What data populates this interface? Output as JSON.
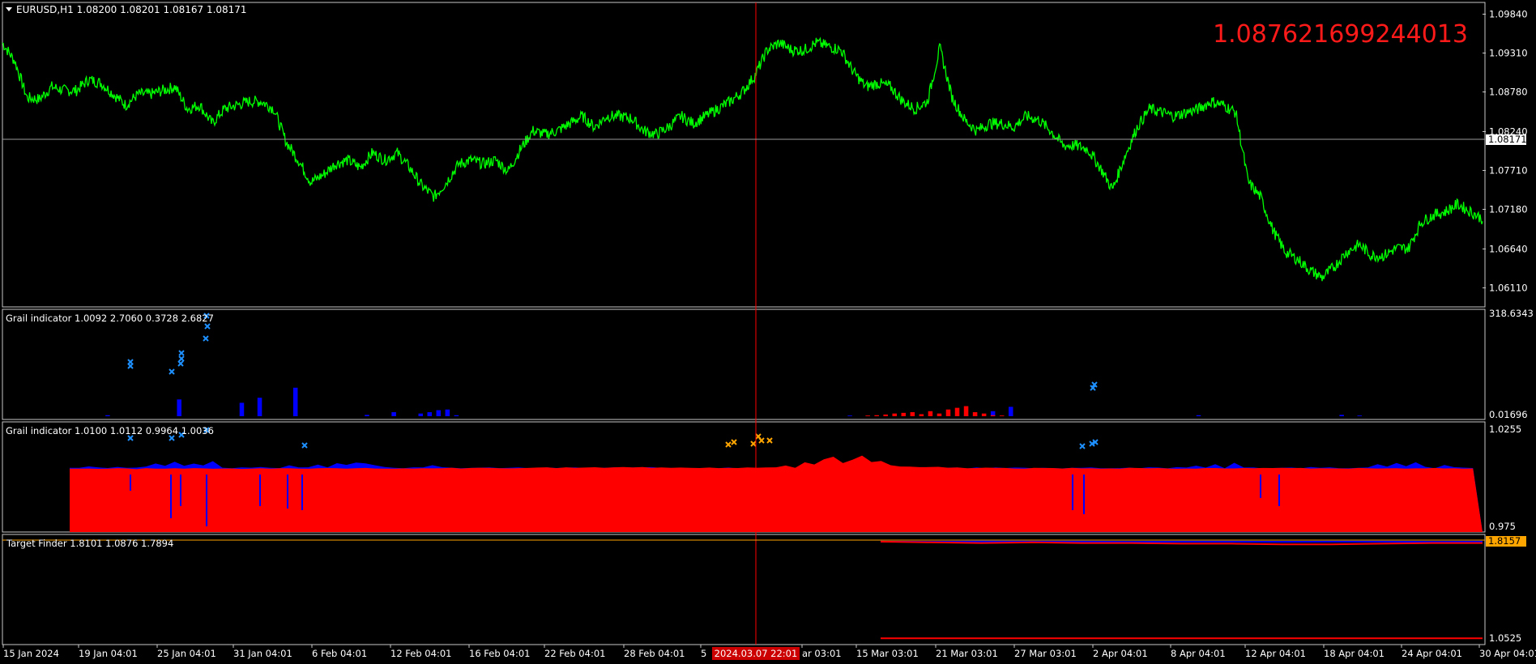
{
  "colors": {
    "background": "#000000",
    "frame": "#c8c8c8",
    "price_line": "#00ff00",
    "grail_blue": "#0000ff",
    "grail_red": "#ff0000",
    "marker_blue": "#1e90ff",
    "marker_orange": "#ffa500",
    "crosshair": "#ff0000",
    "bid_line": "#9a9a9a",
    "target_line": "#ffa500",
    "big_value": "#ff1a1a",
    "text": "#ffffff"
  },
  "main": {
    "header": "EURUSD,H1  1.08200 1.08201 1.08167 1.08171",
    "overlay_value": "1.087621699244013",
    "current_price_tag": "1.08171"
  },
  "grail1": {
    "header": "Grail indicator 1.0092 2.7060 0.3728 2.6827"
  },
  "grail2": {
    "header": "Grail indicator 1.0100 1.0112 0.9964 1.0036"
  },
  "target": {
    "header": "Target Finder 1.8101 1.0876 1.7894",
    "tag": "1.8157"
  },
  "crosshair_date": "2024.03.07 22:01",
  "chart_data": [
    {
      "panel": "main",
      "type": "line",
      "title": "EURUSD,H1",
      "ylim": [
        1.0585,
        1.1
      ],
      "y_ticks": [
        "1.09840",
        "1.09310",
        "1.08780",
        "1.08240",
        "1.07710",
        "1.07180",
        "1.06640",
        "1.06110"
      ],
      "x_ticks": [
        "15 Jan 2024",
        "19 Jan 04:01",
        "25 Jan 04:01",
        "31 Jan 04:01",
        "6 Feb 04:01",
        "12 Feb 04:01",
        "16 Feb 04:01",
        "22 Feb 04:01",
        "28 Feb 04:01",
        "5",
        "ar 03:01",
        "15 Mar 03:01",
        "21 Mar 03:01",
        "27 Mar 03:01",
        "2 Apr 04:01",
        "8 Apr 04:01",
        "12 Apr 04:01",
        "18 Apr 04:01",
        "24 Apr 04:01",
        "30 Apr 04:01"
      ],
      "series": [
        {
          "values": [
            1.0945,
            1.092,
            1.087,
            1.0868,
            1.0885,
            1.088,
            1.088,
            1.0895,
            1.089,
            1.0875,
            1.086,
            1.0875,
            1.0875,
            1.088,
            1.0885,
            1.0855,
            1.086,
            1.0835,
            1.0855,
            1.086,
            1.0865,
            1.0865,
            1.0855,
            1.081,
            1.0785,
            1.0755,
            1.0765,
            1.078,
            1.0785,
            1.0775,
            1.0795,
            1.0785,
            1.0795,
            1.0775,
            1.075,
            1.0735,
            1.0755,
            1.078,
            1.0785,
            1.078,
            1.0785,
            1.077,
            1.08,
            1.0825,
            1.082,
            1.0825,
            1.0835,
            1.0845,
            1.083,
            1.0845,
            1.0845,
            1.0842,
            1.0825,
            1.082,
            1.083,
            1.0845,
            1.0835,
            1.0845,
            1.0855,
            1.0865,
            1.0878,
            1.09,
            1.0935,
            1.0945,
            1.0935,
            1.0935,
            1.0945,
            1.094,
            1.0935,
            1.0905,
            1.0885,
            1.089,
            1.0885,
            1.0865,
            1.0855,
            1.0865,
            1.0938,
            1.087,
            1.084,
            1.0825,
            1.0835,
            1.0835,
            1.083,
            1.0845,
            1.084,
            1.0825,
            1.0805,
            1.0805,
            1.08,
            1.0775,
            1.0745,
            1.079,
            1.083,
            1.0855,
            1.085,
            1.0845,
            1.085,
            1.0855,
            1.0865,
            1.086,
            1.085,
            1.0755,
            1.0735,
            1.069,
            1.066,
            1.065,
            1.0635,
            1.0625,
            1.064,
            1.066,
            1.067,
            1.0655,
            1.0655,
            1.0665,
            1.0665,
            1.07,
            1.071,
            1.0715,
            1.0725,
            1.0715,
            1.0705
          ]
        }
      ]
    },
    {
      "panel": "grail1",
      "type": "bar",
      "title": "Grail indicator",
      "ylim": [
        0,
        318.6343
      ],
      "y_ticks": [
        "318.6343",
        "0.01696"
      ],
      "series": [
        {
          "name": "blue",
          "values": [
            0,
            0,
            0,
            0,
            3,
            0,
            0,
            0,
            0,
            0,
            0,
            0,
            50,
            0,
            0,
            0,
            0,
            0,
            0,
            40,
            0,
            55,
            0,
            0,
            0,
            85,
            0,
            0,
            0,
            0,
            0,
            0,
            0,
            4,
            0,
            0,
            12,
            0,
            0,
            8,
            12,
            18,
            20,
            3,
            0,
            0,
            0,
            0,
            0,
            0,
            0,
            0,
            0,
            0,
            0,
            0,
            0,
            0,
            0,
            0,
            0,
            0,
            0,
            0,
            0,
            0,
            0,
            0,
            0,
            0,
            0,
            0,
            0,
            0,
            0,
            0,
            0,
            0,
            0,
            0,
            0,
            0,
            0,
            0,
            0,
            0,
            0,
            2,
            0,
            0,
            0,
            0,
            0,
            0,
            0,
            0,
            0,
            0,
            0,
            0,
            4,
            3,
            0,
            15,
            0,
            28,
            0,
            0,
            0,
            0,
            0,
            0,
            0,
            0,
            0,
            0,
            0,
            0,
            0,
            0,
            0,
            0,
            0,
            0,
            0,
            0,
            3,
            0,
            0,
            0,
            0,
            0,
            0,
            0,
            0,
            0,
            0,
            0,
            0,
            0,
            0,
            0,
            4,
            0,
            2,
            0,
            0,
            0,
            0,
            0,
            0,
            0,
            0,
            0,
            0,
            0,
            0,
            0
          ]
        },
        {
          "name": "red",
          "values": [
            0,
            0,
            0,
            0,
            0,
            0,
            0,
            0,
            0,
            0,
            0,
            0,
            0,
            0,
            0,
            0,
            0,
            0,
            0,
            0,
            0,
            0,
            0,
            0,
            0,
            0,
            0,
            0,
            0,
            0,
            0,
            0,
            0,
            0,
            0,
            0,
            0,
            0,
            0,
            0,
            0,
            0,
            0,
            0,
            0,
            0,
            0,
            0,
            0,
            0,
            0,
            0,
            0,
            0,
            0,
            0,
            0,
            0,
            0,
            0,
            0,
            0,
            0,
            0,
            0,
            0,
            0,
            0,
            0,
            0,
            0,
            0,
            0,
            0,
            0,
            0,
            0,
            0,
            0,
            0,
            0,
            0,
            0,
            0,
            0,
            0,
            0,
            0,
            0,
            2,
            3,
            5,
            8,
            10,
            12,
            6,
            15,
            8,
            20,
            25,
            30,
            12,
            8,
            3,
            2,
            0,
            0,
            0,
            0,
            0,
            0,
            0,
            0,
            0,
            0,
            0,
            0,
            0,
            0,
            0,
            0,
            0,
            0,
            0,
            0,
            0,
            0,
            0,
            0,
            0,
            0,
            0,
            0,
            0,
            0,
            0,
            0,
            0,
            0,
            0,
            0,
            0,
            0,
            0,
            0,
            0,
            0,
            0,
            0,
            0,
            0,
            0,
            0,
            0,
            0,
            0,
            0,
            0
          ]
        }
      ]
    },
    {
      "panel": "grail2",
      "type": "area",
      "title": "Grail indicator",
      "ylim": [
        0.975,
        1.0255
      ],
      "y_ticks": [
        "1.0255",
        "0.975"
      ],
      "series": [
        {
          "name": "blue",
          "values": [
            0,
            0,
            0,
            0,
            0,
            0,
            0,
            0,
            0,
            0,
            1.0045,
            1.0042,
            1.005,
            1.0043,
            1.0044,
            1.0046,
            1.0045,
            1.0044,
            1.0048,
            1.0062,
            1.0055,
            1.007,
            1.0052,
            1.0065,
            1.0058,
            1.0075,
            1.0046,
            1.0045,
            1.0047,
            1.0045,
            1.0045,
            1.0044,
            1.0045,
            1.0058,
            1.0046,
            1.0045,
            1.0062,
            1.0045,
            1.0065,
            1.0055,
            1.007,
            1.0062,
            1.0058,
            1.0048,
            1.0046,
            1.0045,
            1.0044,
            1.0045,
            1.0054,
            1.0045,
            1.0044,
            1.0045,
            1.0044,
            1.0045,
            1.0044,
            1.0045,
            1.0044,
            1.0045,
            1.0044,
            1.0045,
            1.0044,
            1.0045,
            1.0044,
            1.0045,
            1.0044,
            1.0045,
            1.0044,
            1.0045,
            1.0044,
            1.0045,
            1.0044,
            1.0045,
            1.0044,
            1.0045,
            1.0044,
            1.0045,
            1.0044,
            1.0045,
            1.0044,
            1.0045,
            1.0044,
            1.0045,
            1.0044,
            1.0045,
            1.0044,
            1.0045,
            1.0044,
            1.0045,
            1.0044,
            1.0045,
            1.0044,
            1.0045,
            1.0044,
            1.0045,
            1.0044,
            1.0045,
            1.0044,
            1.0045,
            1.0044,
            1.0045,
            1.0044,
            1.0045,
            1.0044,
            1.0045,
            1.0044,
            1.0045,
            1.0044,
            1.0045,
            1.0044,
            1.0045,
            1.0044,
            1.0045,
            1.0044,
            1.0045,
            1.0044,
            1.0045,
            1.0044,
            1.0045,
            1.0044,
            1.0045,
            1.0044,
            1.0045,
            1.0044,
            1.0048,
            1.0045,
            1.0044,
            1.0045,
            1.0044,
            1.0055,
            1.0045,
            1.0062,
            1.0045,
            1.0068,
            1.0044,
            1.0045,
            1.0044,
            1.0045,
            1.0044,
            1.0045,
            1.0044,
            1.0045,
            1.0044,
            1.0045,
            1.0044,
            1.0045,
            1.0044,
            1.0045,
            1.006,
            1.0048,
            1.0065,
            1.0052,
            1.0068,
            1.0048,
            1.0045,
            1.0055,
            1.0046,
            1.0045,
            1.0044,
            1.0045,
            1.0044,
            1.0045
          ]
        },
        {
          "name": "red",
          "values": [
            0,
            0,
            0,
            0,
            0,
            0,
            0,
            0,
            0,
            0,
            1.0042,
            1.0041,
            1.0042,
            1.004,
            1.0041,
            1.0042,
            1.0041,
            1.004,
            1.0042,
            1.0042,
            1.0041,
            1.0042,
            1.0041,
            1.0042,
            1.0041,
            1.004,
            1.0041,
            1.0042,
            1.0041,
            1.0042,
            1.0041,
            1.0042,
            1.0041,
            1.0042,
            1.0041,
            1.0042,
            1.0041,
            1.0042,
            1.0041,
            1.0042,
            1.0041,
            1.0042,
            1.0041,
            1.0042,
            1.0041,
            1.0042,
            1.0041,
            1.0042,
            1.0043,
            1.0042,
            1.0043,
            1.0042,
            1.0043,
            1.0044,
            1.0043,
            1.0044,
            1.0043,
            1.0044,
            1.0045,
            1.0044,
            1.0045,
            1.0044,
            1.0045,
            1.0046,
            1.0045,
            1.0046,
            1.0045,
            1.0046,
            1.0047,
            1.0046,
            1.0047,
            1.0046,
            1.0047,
            1.0046,
            1.0047,
            1.0046,
            1.0045,
            1.0046,
            1.0045,
            1.0046,
            1.0045,
            1.0046,
            1.0045,
            1.0046,
            1.0045,
            1.0055,
            1.0046,
            1.007,
            1.006,
            1.0085,
            1.0095,
            1.0065,
            1.008,
            1.01,
            1.007,
            1.0075,
            1.0055,
            1.005,
            1.0048,
            1.0047,
            1.0046,
            1.0047,
            1.0046,
            1.0045,
            1.0044,
            1.0045,
            1.0044,
            1.0043,
            1.0044,
            1.0043,
            1.0042,
            1.0043,
            1.0042,
            1.0043,
            1.0042,
            1.0043,
            1.0042,
            1.0043,
            1.0042,
            1.0043,
            1.0042,
            1.0043,
            1.0042,
            1.0043,
            1.0042,
            1.0043,
            1.0042,
            1.0043,
            1.0042,
            1.0043,
            1.0042,
            1.0043,
            1.0042,
            1.0043,
            1.0042,
            1.0043,
            1.0042,
            1.0043,
            1.0042,
            1.0043,
            1.0042,
            1.0043,
            1.0042,
            1.0043,
            1.0042,
            1.0043,
            1.0042,
            1.0043,
            1.0042,
            1.0043,
            1.0042,
            1.0043,
            1.0042,
            1.0043,
            1.0042,
            1.0043,
            1.0042,
            1.0043
          ]
        }
      ]
    },
    {
      "panel": "target",
      "type": "line",
      "title": "Target Finder",
      "ylim": [
        1.0525,
        1.8157
      ],
      "y_ticks": [
        "1.8157",
        "1.0525"
      ],
      "series": [
        {
          "name": "blue",
          "start": "2024.03.13",
          "values": [
            1.81,
            1.809,
            1.811,
            1.81,
            1.81,
            1.809,
            1.81,
            1.81,
            1.809,
            1.81,
            1.81,
            1.809,
            1.81
          ]
        },
        {
          "name": "red upper",
          "start": "2024.03.13",
          "values": [
            1.81,
            1.805,
            1.8,
            1.805,
            1.8,
            1.8,
            1.795,
            1.795,
            1.79,
            1.79,
            1.795,
            1.8,
            1.8
          ]
        },
        {
          "name": "red lower",
          "start": "2024.03.13",
          "values": [
            1.0876,
            1.0876,
            1.0876,
            1.0876,
            1.0876,
            1.0876,
            1.0876,
            1.0876,
            1.0876,
            1.0876,
            1.0876,
            1.0876,
            1.0876
          ]
        }
      ]
    }
  ]
}
